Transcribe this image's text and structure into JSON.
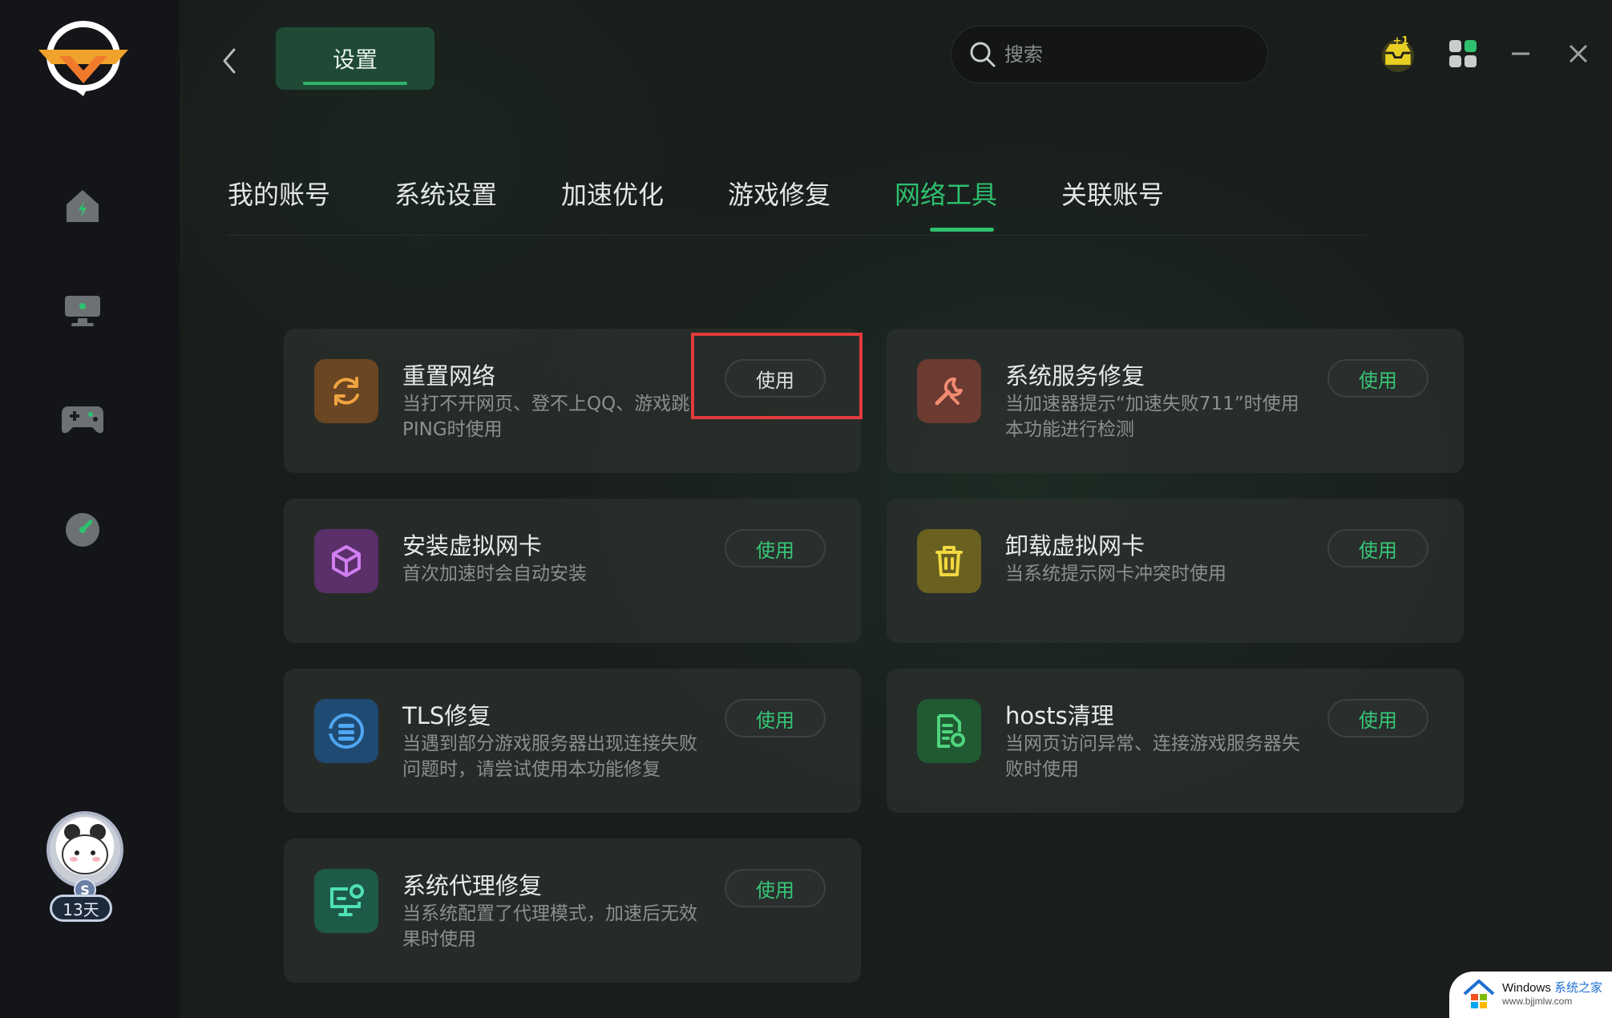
{
  "header": {
    "title": "设置",
    "search_placeholder": "搜索"
  },
  "tabs": [
    {
      "label": "我的账号",
      "active": false
    },
    {
      "label": "系统设置",
      "active": false
    },
    {
      "label": "加速优化",
      "active": false
    },
    {
      "label": "游戏修复",
      "active": false
    },
    {
      "label": "网络工具",
      "active": true
    },
    {
      "label": "关联账号",
      "active": false
    }
  ],
  "tools": [
    {
      "title": "重置网络",
      "desc": "当打不开网页、登不上QQ、游戏跳PING时使用",
      "button": "使用",
      "icon": "refresh-icon",
      "color": "#d98a2c"
    },
    {
      "title": "系统服务修复",
      "desc": "当加速器提示“加速失败711”时使用本功能进行检测",
      "button": "使用",
      "icon": "wrench-icon",
      "color": "#e0735a"
    },
    {
      "title": "安装虚拟网卡",
      "desc": "首次加速时会自动安装",
      "button": "使用",
      "icon": "cube-icon",
      "color": "#b25ad6"
    },
    {
      "title": "卸载虚拟网卡",
      "desc": "当系统提示网卡冲突时使用",
      "button": "使用",
      "icon": "trash-icon",
      "color": "#e0c82e"
    },
    {
      "title": "TLS修复",
      "desc": "当遇到部分游戏服务器出现连接失败问题时，请尝试使用本功能修复",
      "button": "使用",
      "icon": "tls-icon",
      "color": "#3e8ee6"
    },
    {
      "title": "hosts清理",
      "desc": "当网页访问异常、连接游戏服务器失败时使用",
      "button": "使用",
      "icon": "file-clean-icon",
      "color": "#3fbf6a"
    },
    {
      "title": "系统代理修复",
      "desc": "当系统配置了代理模式，加速后无效果时使用",
      "button": "使用",
      "icon": "monitor-proxy-icon",
      "color": "#36c7a0"
    }
  ],
  "sidebar": {
    "items": [
      "home-icon",
      "monitor-icon",
      "gamepad-icon",
      "speedometer-icon"
    ],
    "avatar_level": "S",
    "avatar_days": "13天"
  },
  "watermark": {
    "line1_a": "Windows",
    "line1_b": "系统之家",
    "line2": "www.bjjmlw.com"
  },
  "colors": {
    "accent": "#2fc06e",
    "highlight": "#e23b3b"
  }
}
